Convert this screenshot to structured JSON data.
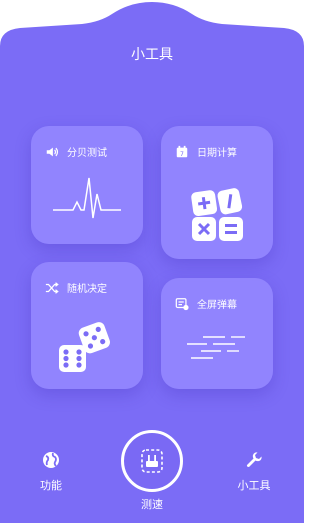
{
  "header": {
    "title": "小工具"
  },
  "cards": [
    {
      "label": "分贝测试",
      "icon": "speaker-icon"
    },
    {
      "label": "日期计算",
      "icon": "calendar-icon"
    },
    {
      "label": "随机决定",
      "icon": "shuffle-icon"
    },
    {
      "label": "全屏弹幕",
      "icon": "danmaku-icon"
    }
  ],
  "nav": {
    "left_label": "功能",
    "center_label": "测速",
    "right_label": "小工具"
  },
  "colors": {
    "background_panel": "#7b6cf6",
    "card": "#968aff",
    "text": "#ffffff"
  }
}
